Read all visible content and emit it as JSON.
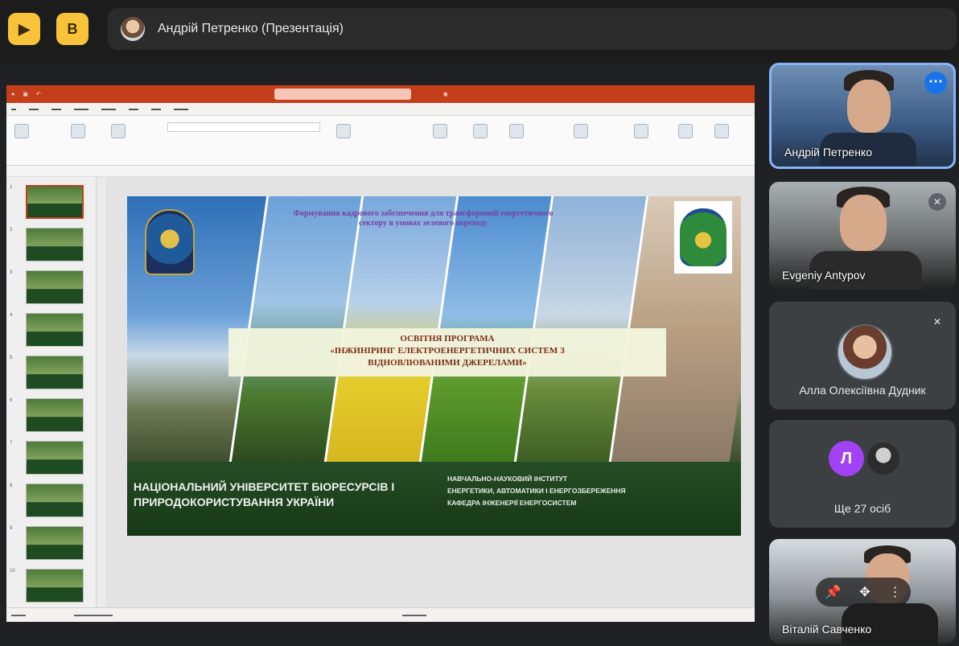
{
  "topbar": {
    "button1_icon": "present-off-icon",
    "button2_icon": "captions-icon",
    "presenter_label": "Андрій Петренко (Презентація)"
  },
  "presentation": {
    "slide_count_numbers": [
      "1",
      "2",
      "3",
      "4",
      "5",
      "6",
      "7",
      "8",
      "9",
      "10"
    ],
    "slide": {
      "top_text": "Формування кадрового забезпечення для трансформації енергетичного сектору в умовах зеленого переходу",
      "box_line1": "ОСВІТНЯ ПРОГРАМА",
      "box_line2": "«ІНЖИНІРИНГ ЕЛЕКТРОЕНЕРГЕТИЧНИХ СИСТЕМ З",
      "box_line3": "ВІДНОВЛЮВАНИМИ ДЖЕРЕЛАМИ»",
      "university": "НАЦІОНАЛЬНИЙ УНІВЕРСИТЕТ БІОРЕСУРСІВ І ПРИРОДОКОРИСТУВАННЯ УКРАЇНИ",
      "institute_line1": "НАВЧАЛЬНО-НАУКОВИЙ ІНСТИТУТ",
      "institute_line2": "ЕНЕРГЕТИКИ, АВТОМАТИКИ І ЕНЕРГОЗБЕРЕЖЕННЯ",
      "institute_line3": "КАФЕДРА ІНЖЕНЕРІЇ ЕНЕРГОСИСТЕМ"
    }
  },
  "participants": [
    {
      "name": "Андрій Петренко",
      "active": true
    },
    {
      "name": "Evgeniy Antypov"
    },
    {
      "name": "Алла Олексіївна Дудник"
    },
    {
      "initial": "Л",
      "others_label": "Ще 27 осіб"
    },
    {
      "name": "Віталій Савченко"
    }
  ],
  "colors": {
    "accent_yellow": "#f6c33b",
    "ppt_red": "#c43e1c",
    "active_border": "#8ab4f8",
    "bg": "#202124"
  }
}
